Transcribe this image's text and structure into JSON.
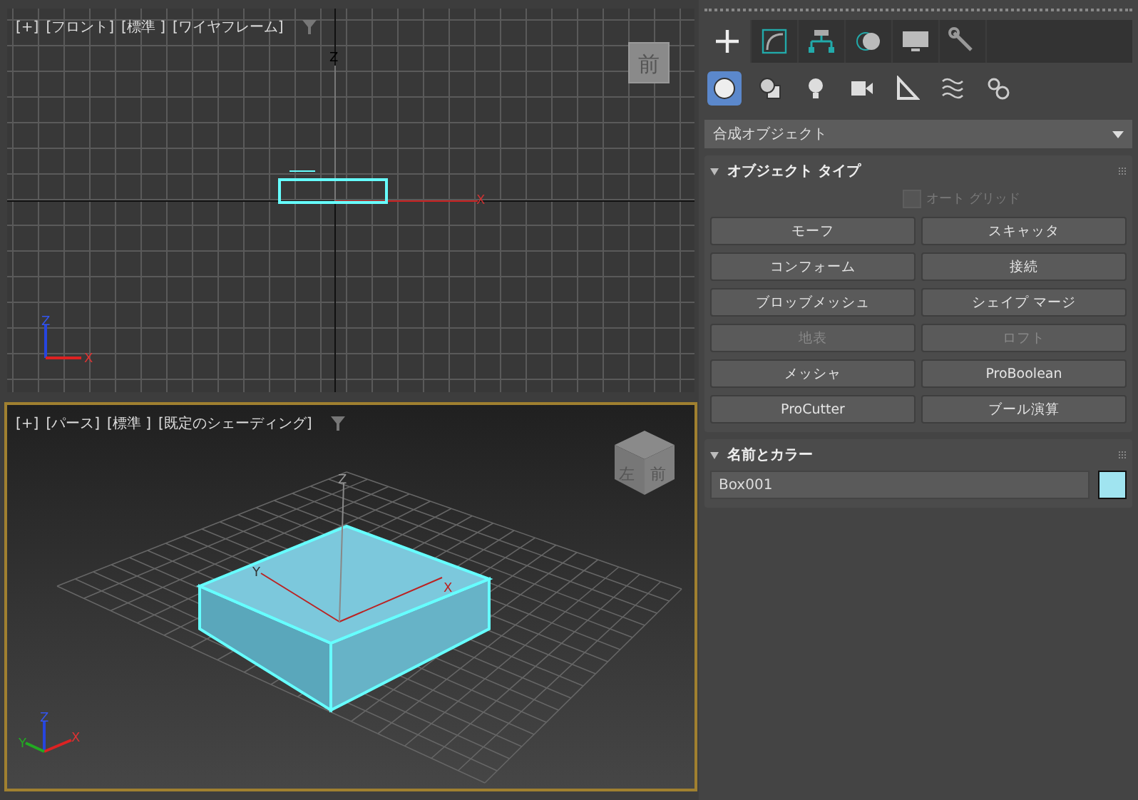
{
  "viewports": [
    {
      "kind": "front",
      "active": false,
      "menus": [
        "[+]",
        "[フロント]",
        "[標準 ]",
        "[ワイヤフレーム]"
      ],
      "viewcube": [
        "前"
      ],
      "axis_labels": [
        "Z",
        "X",
        "Z",
        "X"
      ]
    },
    {
      "kind": "perspective",
      "active": true,
      "menus": [
        "[+]",
        "[パース]",
        "[標準 ]",
        "[既定のシェーディング]"
      ],
      "viewcube": [
        "左",
        "前"
      ],
      "axis_labels": [
        "Y",
        "X",
        "Z",
        "Y",
        "X",
        "Z"
      ]
    }
  ],
  "panel": {
    "tabs": [
      {
        "kind": "create",
        "selected": true
      },
      {
        "kind": "modify",
        "selected": false
      },
      {
        "kind": "hierarchy",
        "selected": false
      },
      {
        "kind": "motion",
        "selected": false
      },
      {
        "kind": "display",
        "selected": false
      },
      {
        "kind": "utilities",
        "selected": false
      }
    ],
    "categories": [
      {
        "kind": "geometry",
        "selected": true
      },
      {
        "kind": "shapes",
        "selected": false
      },
      {
        "kind": "lights",
        "selected": false
      },
      {
        "kind": "cameras",
        "selected": false
      },
      {
        "kind": "helpers",
        "selected": false
      },
      {
        "kind": "spacewarps",
        "selected": false
      },
      {
        "kind": "systems",
        "selected": false
      }
    ],
    "dropdown": "合成オブジェクト",
    "object_type": {
      "title": "オブジェクト タイプ",
      "expanded": true,
      "autogrid": {
        "label": "オート グリッド",
        "checked": false,
        "disabled": true
      },
      "buttons": [
        {
          "label": "モーフ",
          "disabled": false
        },
        {
          "label": "スキャッタ",
          "disabled": false
        },
        {
          "label": "コンフォーム",
          "disabled": false
        },
        {
          "label": "接続",
          "disabled": false
        },
        {
          "label": "ブロッブメッシュ",
          "disabled": false
        },
        {
          "label": "シェイプ マージ",
          "disabled": false
        },
        {
          "label": "地表",
          "disabled": true
        },
        {
          "label": "ロフト",
          "disabled": true
        },
        {
          "label": "メッシャ",
          "disabled": false
        },
        {
          "label": "ProBoolean",
          "disabled": false
        },
        {
          "label": "ProCutter",
          "disabled": false
        },
        {
          "label": "ブール演算",
          "disabled": false
        }
      ]
    },
    "name_color": {
      "title": "名前とカラー",
      "expanded": true,
      "name": "Box001",
      "color": "#a0e4f0"
    }
  }
}
